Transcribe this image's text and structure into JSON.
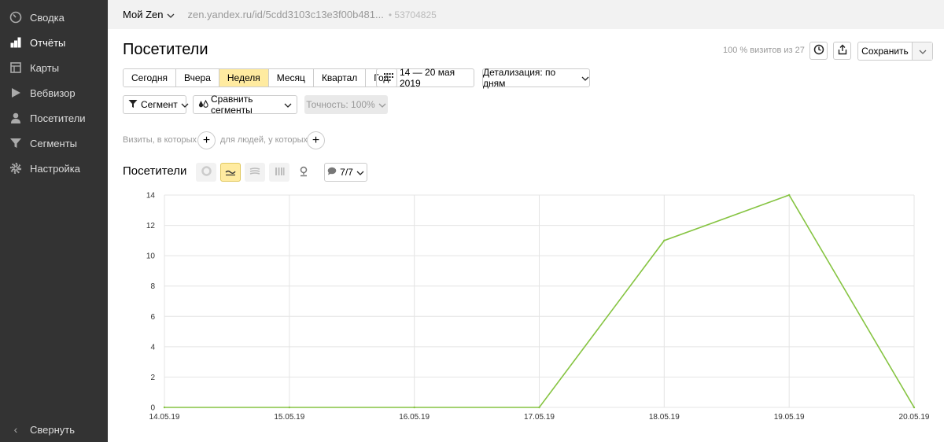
{
  "sidebar": {
    "items": [
      {
        "label": "Сводка",
        "icon": "gauge-icon"
      },
      {
        "label": "Отчёты",
        "icon": "bar-chart-icon"
      },
      {
        "label": "Карты",
        "icon": "map-icon"
      },
      {
        "label": "Вебвизор",
        "icon": "play-icon"
      },
      {
        "label": "Посетители",
        "icon": "user-icon"
      },
      {
        "label": "Сегменты",
        "icon": "funnel-icon"
      },
      {
        "label": "Настройка",
        "icon": "gear-icon"
      }
    ],
    "active": "Отчёты",
    "collapse_label": "Свернуть"
  },
  "topbar": {
    "site_name": "Мой Zen",
    "site_url": "zen.yandex.ru/id/5cdd3103c13e3f00b481...",
    "site_id": "• 53704825"
  },
  "header": {
    "title": "Посетители",
    "visits_note": "100 % визитов из 27",
    "save_label": "Сохранить"
  },
  "period": {
    "buttons": [
      "Сегодня",
      "Вчера",
      "Неделя",
      "Месяц",
      "Квартал",
      "Год"
    ],
    "active": "Неделя",
    "date_range": "14 — 20 мая 2019",
    "detail": "Детализация: по дням"
  },
  "segments": {
    "segment_label": "Сегмент",
    "compare_label": "Сравнить сегменты",
    "accuracy_label": "Точность: 100%",
    "visits_filter": "Визиты, в которых",
    "people_filter": "для людей, у которых"
  },
  "chart_header": {
    "title": "Посетители",
    "metrics_label": "7/7"
  },
  "colors": {
    "line": "#86c442",
    "weekend_tick": "#cc2222",
    "active_button": "#ffeba0",
    "sidebar_bg": "#333333"
  },
  "chart_data": {
    "type": "line",
    "categories": [
      "14.05.19",
      "15.05.19",
      "16.05.19",
      "17.05.19",
      "18.05.19",
      "19.05.19",
      "20.05.19"
    ],
    "weekend": [
      false,
      false,
      false,
      false,
      true,
      true,
      false
    ],
    "series": [
      {
        "values": [
          0,
          0,
          0,
          0,
          11,
          14,
          0
        ]
      }
    ],
    "yticks": [
      0,
      2,
      4,
      6,
      8,
      10,
      12,
      14
    ],
    "ylim": [
      0,
      14
    ],
    "grid": true
  }
}
